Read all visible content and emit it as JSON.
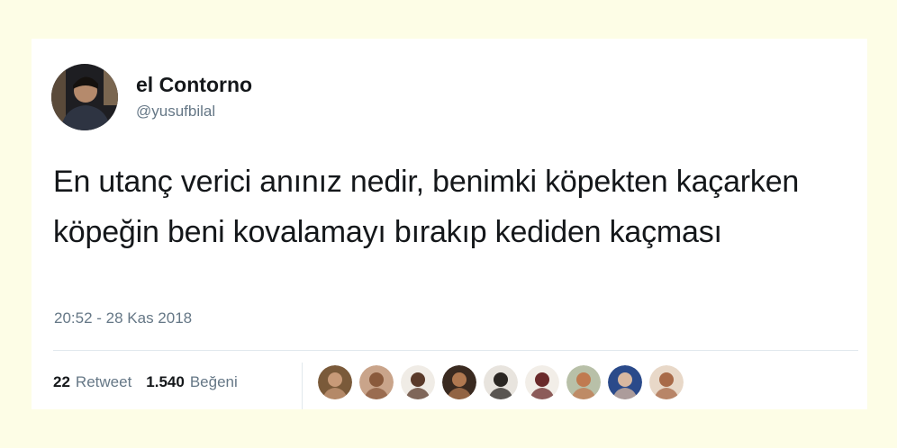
{
  "tweet": {
    "display_name": "el Contorno",
    "handle": "@yusufbilal",
    "text": "En utanç verici anınız nedir, benimki köpekten kaçarken köpeğin beni kovalamayı bırakıp kediden kaçması",
    "timestamp": "20:52 - 28 Kas 2018",
    "retweet_count": "22",
    "retweet_label": "Retweet",
    "like_count": "1.540",
    "like_label": "Beğeni"
  },
  "colors": {
    "page_background": "#fdfde6",
    "card_background": "#ffffff",
    "text_primary": "#14171a",
    "text_secondary": "#657786",
    "divider": "#e1e8ed"
  },
  "liker_avatars": [
    {
      "name": "liker-avatar-1",
      "bg": "#7a5a3a",
      "face": "#c89a78"
    },
    {
      "name": "liker-avatar-2",
      "bg": "#c9a48a",
      "face": "#8a5a3c"
    },
    {
      "name": "liker-avatar-3",
      "bg": "#f0ece6",
      "face": "#5a3a2a"
    },
    {
      "name": "liker-avatar-4",
      "bg": "#3a2a20",
      "face": "#b07850"
    },
    {
      "name": "liker-avatar-5",
      "bg": "#e8e4de",
      "face": "#2a2622"
    },
    {
      "name": "liker-avatar-6",
      "bg": "#f2eee8",
      "face": "#6a2a2a"
    },
    {
      "name": "liker-avatar-7",
      "bg": "#b8c0a8",
      "face": "#c07a50"
    },
    {
      "name": "liker-avatar-8",
      "bg": "#2a4a8a",
      "face": "#d8b8a0"
    },
    {
      "name": "liker-avatar-9",
      "bg": "#e8d8c8",
      "face": "#a86a48"
    }
  ]
}
